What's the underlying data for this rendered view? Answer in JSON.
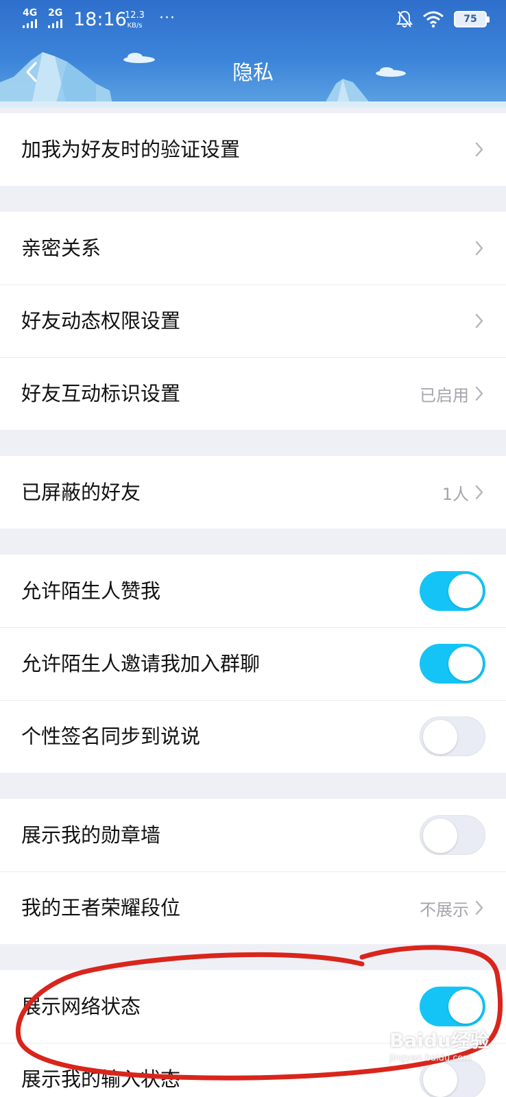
{
  "status_bar": {
    "network_1": "4G",
    "network_2": "2G",
    "time": "18:16",
    "speed_value": "12.3",
    "speed_unit": "KB/s",
    "more": "···",
    "battery": "75"
  },
  "nav": {
    "title": "隐私",
    "back_icon": "chevron-left-icon"
  },
  "sections": [
    {
      "rows": [
        {
          "label": "加我为好友时的验证设置",
          "value": "",
          "control": "chevron"
        }
      ]
    },
    {
      "rows": [
        {
          "label": "亲密关系",
          "value": "",
          "control": "chevron"
        },
        {
          "label": "好友动态权限设置",
          "value": "",
          "control": "chevron"
        },
        {
          "label": "好友互动标识设置",
          "value": "已启用",
          "control": "chevron"
        }
      ]
    },
    {
      "rows": [
        {
          "label": "已屏蔽的好友",
          "value": "1人",
          "control": "chevron"
        }
      ]
    },
    {
      "rows": [
        {
          "label": "允许陌生人赞我",
          "control": "toggle",
          "on": true
        },
        {
          "label": "允许陌生人邀请我加入群聊",
          "control": "toggle",
          "on": true
        },
        {
          "label": "个性签名同步到说说",
          "control": "toggle",
          "on": false
        }
      ]
    },
    {
      "rows": [
        {
          "label": "展示我的勋章墙",
          "control": "toggle",
          "on": false
        },
        {
          "label": "我的王者荣耀段位",
          "value": "不展示",
          "control": "chevron"
        }
      ]
    },
    {
      "rows": [
        {
          "label": "展示网络状态",
          "control": "toggle",
          "on": true
        },
        {
          "label": "展示我的输入状态",
          "control": "toggle",
          "on": false
        }
      ]
    }
  ],
  "watermark": {
    "text": "Baidu经验",
    "sub": "jingyan.baidu.com"
  },
  "colors": {
    "header": "#3a7fd5",
    "toggle_on": "#14c4f6",
    "annotation": "#d9251c"
  }
}
